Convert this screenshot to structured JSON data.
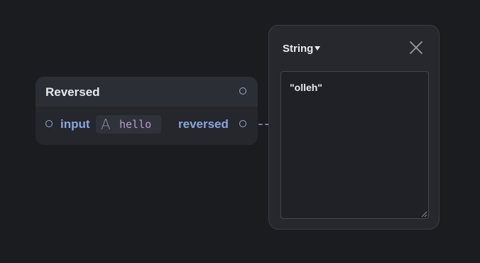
{
  "node": {
    "title": "Reversed",
    "input_label": "input",
    "input_value": "hello",
    "input_type_glyph": "A",
    "output_label": "reversed"
  },
  "inspector": {
    "type_label": "String",
    "value": "\"olleh\""
  },
  "colors": {
    "background": "#1b1c20",
    "node_body": "#25272d",
    "node_header": "#2c2e35",
    "port_label": "#8aa6e0",
    "string_value": "#b59bd8",
    "port_ring": "#93a8d6"
  },
  "icons": {
    "close": "close-icon",
    "caret": "caret-down-icon",
    "type": "string-type-icon",
    "grip": "resize-grip-icon"
  }
}
